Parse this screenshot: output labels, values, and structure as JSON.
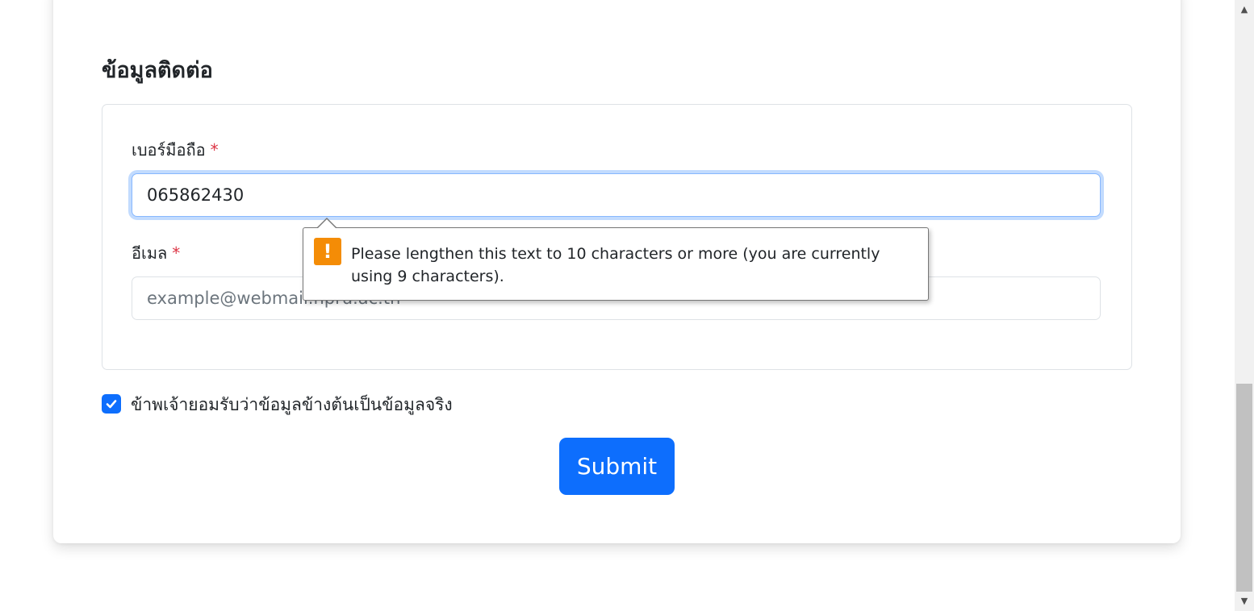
{
  "section": {
    "title": "ข้อมูลติดต่อ"
  },
  "phone": {
    "label": "เบอร์มือถือ",
    "required_mark": "*",
    "value": "065862430"
  },
  "email": {
    "label": "อีเมล",
    "required_mark": "*",
    "placeholder": "example@webmail.npru.ac.th"
  },
  "tooltip": {
    "icon": "warning-icon",
    "icon_glyph": "!",
    "message": "Please lengthen this text to 10 characters or more (you are currently using 9 characters)."
  },
  "consent": {
    "checked": true,
    "label": "ข้าพเจ้ายอมรับว่าข้อมูลข้างต้นเป็นข้อมูลจริง"
  },
  "submit": {
    "label": "Submit"
  },
  "colors": {
    "primary": "#0d6efd",
    "required": "#dc3545",
    "warning": "#f48c06"
  },
  "scrollbar": {
    "up_glyph": "▲",
    "down_glyph": "▼"
  }
}
